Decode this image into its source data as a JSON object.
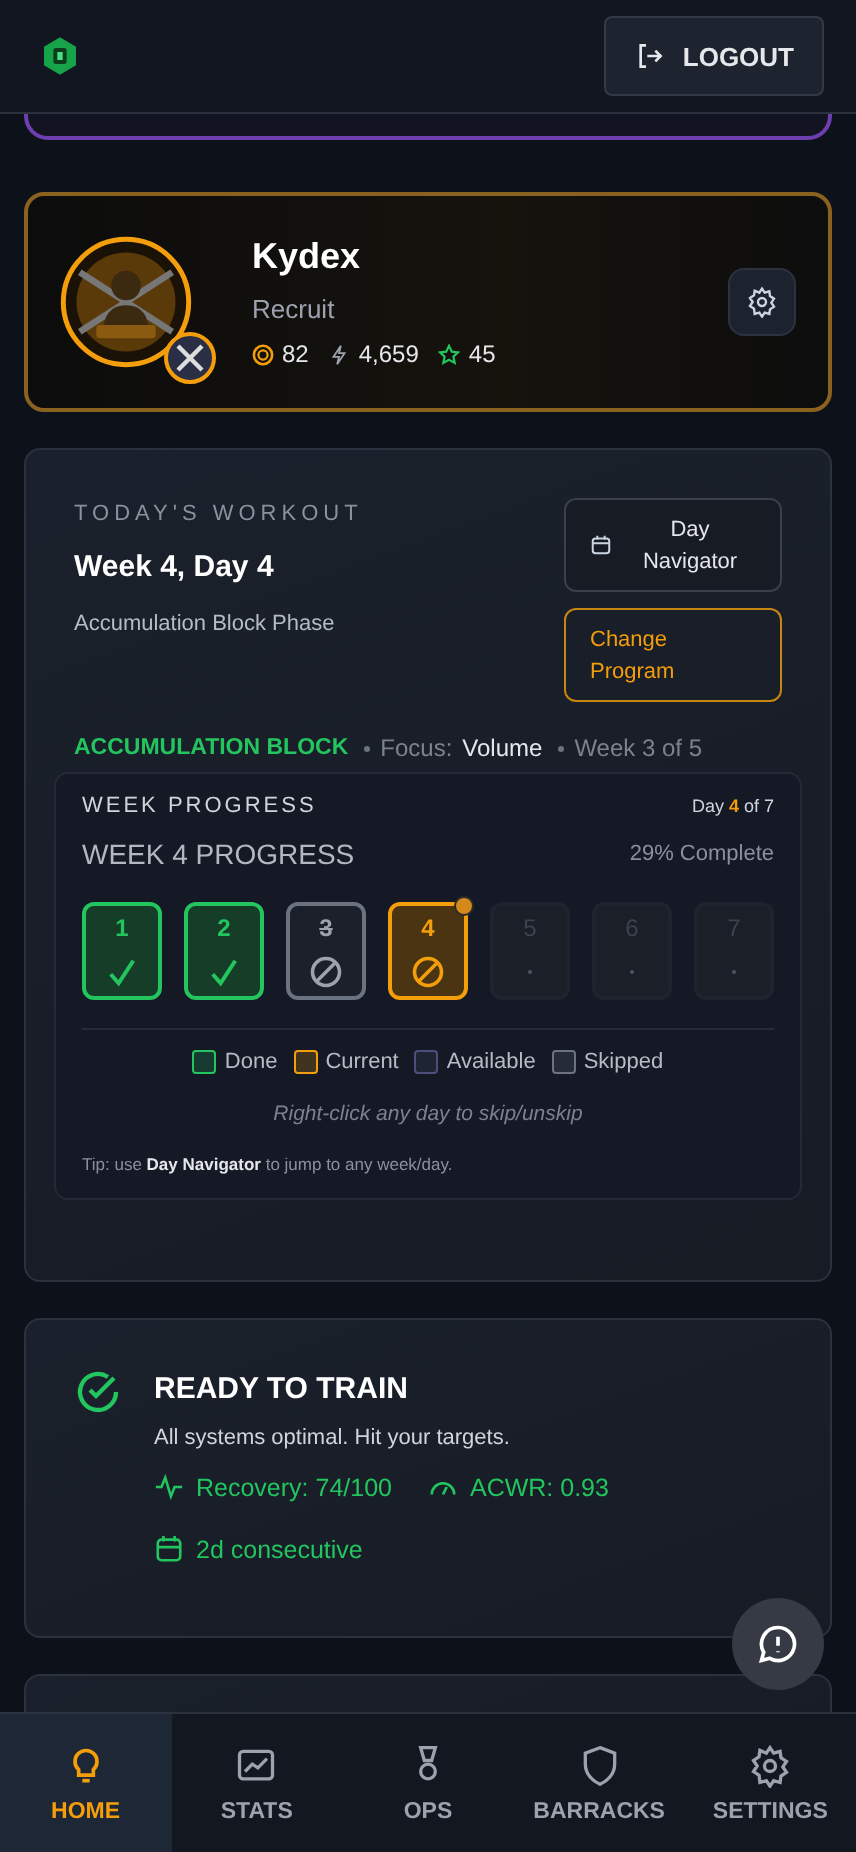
{
  "header": {
    "logout": "LOGOUT"
  },
  "profile": {
    "name": "Kydex",
    "rank": "Recruit",
    "stats": [
      {
        "kind": "coins",
        "value": "82"
      },
      {
        "kind": "power",
        "value": "4,659"
      },
      {
        "kind": "stars",
        "value": "45"
      }
    ]
  },
  "workout": {
    "eyebrow": "TODAY'S WORKOUT",
    "title": "Week 4, Day 4",
    "phase": "Accumulation Block Phase",
    "day_navigator": "Day Navigator",
    "change_program": "Change Program",
    "block": {
      "name": "ACCUMULATION BLOCK",
      "focus_label": "Focus:",
      "focus_value": "Volume",
      "week": "Week 3 of 5"
    },
    "week_progress": {
      "heading": "WEEK PROGRESS",
      "day_of": "Day **4** of 7",
      "title": "WEEK 4 PROGRESS",
      "complete": "29% Complete",
      "days": [
        {
          "label": "1",
          "kind": "done"
        },
        {
          "label": "2",
          "kind": "done"
        },
        {
          "label": "3",
          "kind": "skipped"
        },
        {
          "label": "4",
          "kind": "current"
        },
        {
          "label": "5",
          "kind": "locked"
        },
        {
          "label": "6",
          "kind": "locked"
        },
        {
          "label": "7",
          "kind": "locked"
        }
      ],
      "legend": [
        {
          "label": "Done",
          "color": "#22c55e"
        },
        {
          "label": "Current",
          "color": "#f59e0b"
        },
        {
          "label": "Available",
          "color": "#4b4f7a"
        },
        {
          "label": "Skipped",
          "color": "#6b7280"
        }
      ],
      "hint": "Right-click any day to skip/unskip",
      "tip": "Tip: use **Day Navigator** to jump to any week/day."
    }
  },
  "readiness": {
    "title": "READY TO TRAIN",
    "message": "All systems optimal. Hit your targets.",
    "metrics": [
      {
        "kind": "recovery",
        "text": "Recovery: 74/100"
      },
      {
        "kind": "acwr",
        "text": "ACWR: 0.93"
      },
      {
        "kind": "streak",
        "text": "2d consecutive"
      }
    ]
  },
  "nav": [
    {
      "label": "HOME",
      "kind": "home",
      "selected": true
    },
    {
      "label": "STATS",
      "kind": "stats",
      "selected": false
    },
    {
      "label": "OPS",
      "kind": "ops",
      "selected": false
    },
    {
      "label": "BARRACKS",
      "kind": "barracks",
      "selected": false
    },
    {
      "label": "SETTINGS",
      "kind": "settings",
      "selected": false
    }
  ]
}
